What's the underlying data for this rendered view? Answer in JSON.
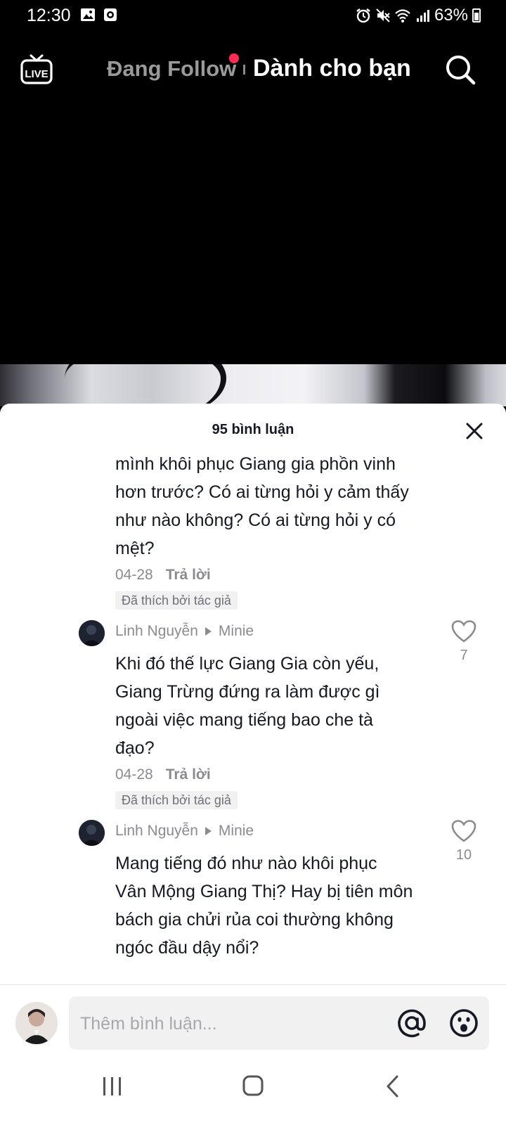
{
  "status_bar": {
    "time": "12:30",
    "battery": "63%"
  },
  "top_nav": {
    "following": "Đang Follow",
    "for_you": "Dành cho bạn"
  },
  "comments_panel": {
    "title": "95 bình luận",
    "comments": [
      {
        "lines": [
          "mình khôi phục Giang gia phồn vinh",
          "hơn trước? Có ai từng hỏi y cảm thấy",
          "như nào không? Có ai từng hỏi y có",
          "mệt?"
        ],
        "date": "04-28",
        "reply_label": "Trả lời",
        "liked_by_author": "Đã thích bởi tác giả"
      },
      {
        "author": "Linh Nguyễn",
        "reply_to": "Minie",
        "lines": [
          "Khi đó thế lực Giang Gia còn yếu,",
          "Giang Trừng đứng ra làm được gì",
          "ngoài việc mang tiếng bao che tà",
          "đạo?"
        ],
        "date": "04-28",
        "reply_label": "Trả lời",
        "liked_by_author": "Đã thích bởi tác giả",
        "likes": "7"
      },
      {
        "author": "Linh Nguyễn",
        "reply_to": "Minie",
        "lines": [
          "Mang tiếng đó như nào khôi phục",
          "Vân Mộng Giang Thị? Hay bị tiên môn",
          "bách gia chửi rủa coi thường không",
          "ngóc đầu dậy nổi?"
        ],
        "likes": "10"
      }
    ]
  },
  "input": {
    "placeholder": "Thêm bình luận..."
  },
  "colors": {
    "accent": "#fe2c55",
    "text": "#161823",
    "secondary": "#8a8b91"
  }
}
